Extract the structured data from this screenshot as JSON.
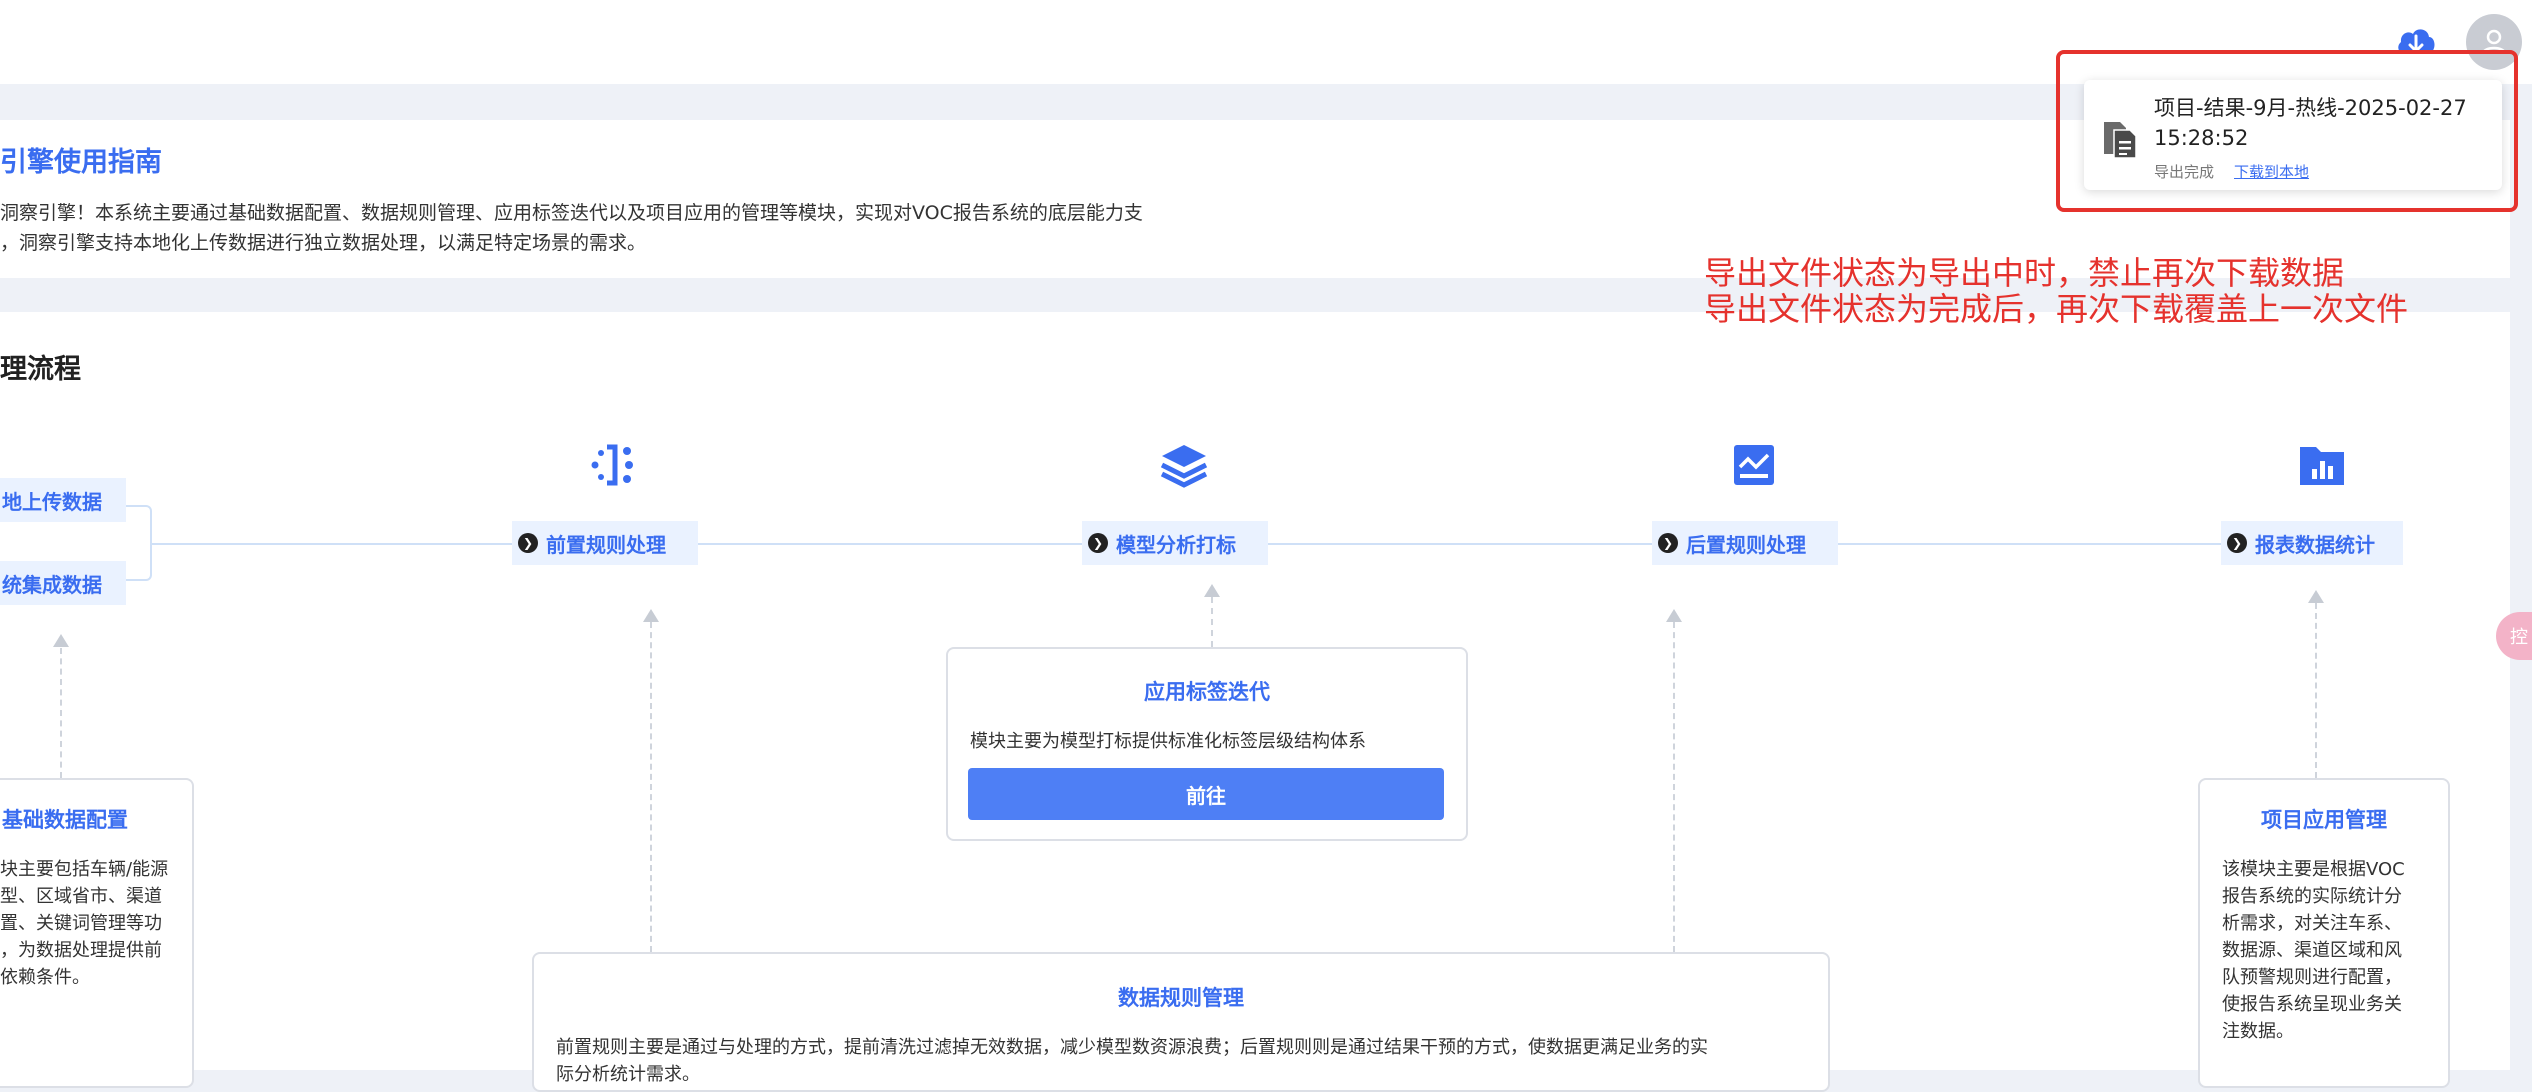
{
  "guide": {
    "title": "引擎使用指南",
    "line1": "洞察引擎！本系统主要通过基础数据配置、数据规则管理、应用标签迭代以及项目应用的管理等模块，实现对VOC报告系统的底层能力支",
    "line2": "，洞察引擎支持本地化上传数据进行独立数据处理，以满足特定场景的需求。"
  },
  "flow": {
    "title": "理流程",
    "sources": [
      "地上传数据",
      "统集成数据"
    ],
    "steps": [
      {
        "label": "前置规则处理",
        "icon": "rule-split-icon"
      },
      {
        "label": "模型分析打标",
        "icon": "layers-icon"
      },
      {
        "label": "后置规则处理",
        "icon": "trend-chart-icon"
      },
      {
        "label": "报表数据统计",
        "icon": "bar-folder-icon"
      }
    ],
    "base_config": {
      "title": "基础数据配置",
      "lines": [
        "块主要包括车辆/能源",
        "型、区域省市、渠道",
        "置、关键词管理等功",
        "，为数据处理提供前",
        "依赖条件。"
      ]
    },
    "label_iteration": {
      "title": "应用标签迭代",
      "text": "模块主要为模型打标提供标准化标签层级结构体系",
      "button": "前往"
    },
    "data_rules": {
      "title": "数据规则管理",
      "line1": "前置规则主要是通过与处理的方式，提前清洗过滤掉无效数据，减少模型数资源浪费；后置规则则是通过结果干预的方式，使数据更满足业务的实",
      "line2": "际分析统计需求。"
    },
    "project_mgmt": {
      "title": "项目应用管理",
      "lines": [
        "该模块主要是根据VOC",
        "报告系统的实际统计分",
        "析需求，对关注车系、",
        "数据源、渠道区域和风",
        "队预警规则进行配置，",
        "使报告系统呈现业务关",
        "注数据。"
      ]
    }
  },
  "export_popup": {
    "file_name_line1": "项目-结果-9月-热线-2025-02-27",
    "file_name_line2": "15:28:52",
    "status": "导出完成",
    "download_link": "下载到本地"
  },
  "annotation": {
    "line1": "导出文件状态为导出中时，禁止再次下载数据",
    "line2": "导出文件状态为完成后，再次下载覆盖上一次文件"
  },
  "side_float": {
    "label": "控"
  },
  "colors": {
    "accent": "#3a6df0",
    "button": "#4e7ff5",
    "annotation": "#e5322d"
  }
}
